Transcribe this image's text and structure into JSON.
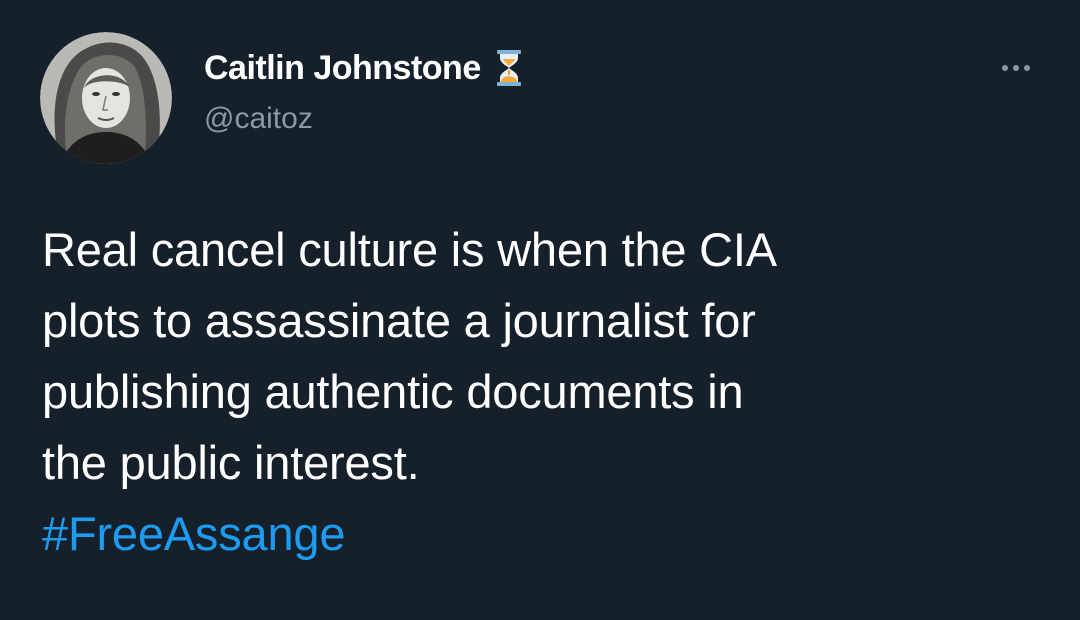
{
  "author": {
    "display_name": "Caitlin Johnstone",
    "handle": "@caitoz",
    "badge_icon": "hourglass-icon"
  },
  "tweet": {
    "lines": [
      "Real cancel culture is when the CIA",
      "plots to assassinate a journalist for",
      "publishing authentic documents in",
      "the public interest."
    ],
    "hashtag": "#FreeAssange"
  },
  "menu": {
    "icon": "more-options-icon"
  },
  "colors": {
    "background": "#15202b",
    "text": "#ffffff",
    "secondary_text": "#8b98a5",
    "link": "#1d9bf0",
    "hourglass_sand": "#f4a93b",
    "hourglass_frame": "#7fb3d5"
  }
}
